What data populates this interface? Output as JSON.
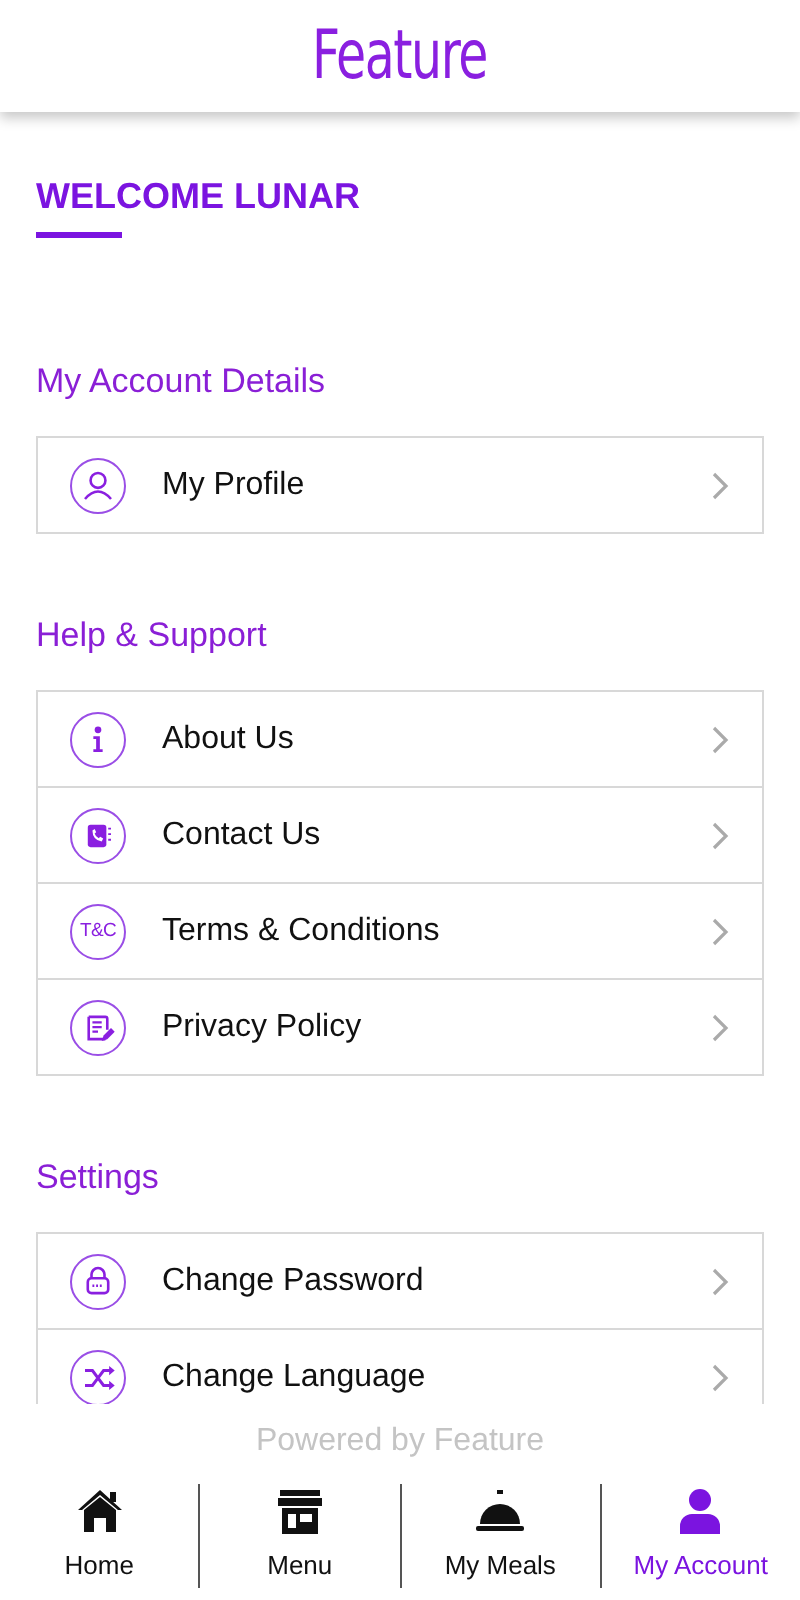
{
  "header": {
    "logo": "Feature"
  },
  "welcome": {
    "title": "WELCOME LUNAR"
  },
  "sections": [
    {
      "title": "My Account Details",
      "items": [
        {
          "label": "My Profile",
          "kind": "person"
        }
      ]
    },
    {
      "title": "Help & Support",
      "items": [
        {
          "label": "About Us",
          "kind": "info"
        },
        {
          "label": "Contact Us",
          "kind": "contact"
        },
        {
          "label": "Terms & Conditions",
          "kind": "text",
          "icon_text": "T&C"
        },
        {
          "label": "Privacy Policy",
          "kind": "document"
        }
      ]
    },
    {
      "title": "Settings",
      "items": [
        {
          "label": "Change Password",
          "kind": "lock"
        },
        {
          "label": "Change Language",
          "kind": "shuffle"
        }
      ]
    }
  ],
  "footer": {
    "powered_by": "Powered by Feature"
  },
  "nav": [
    {
      "label": "Home",
      "kind": "home",
      "selected": false
    },
    {
      "label": "Menu",
      "kind": "store",
      "selected": false
    },
    {
      "label": "My Meals",
      "kind": "cloche",
      "selected": false
    },
    {
      "label": "My Account",
      "kind": "person",
      "selected": true
    }
  ]
}
